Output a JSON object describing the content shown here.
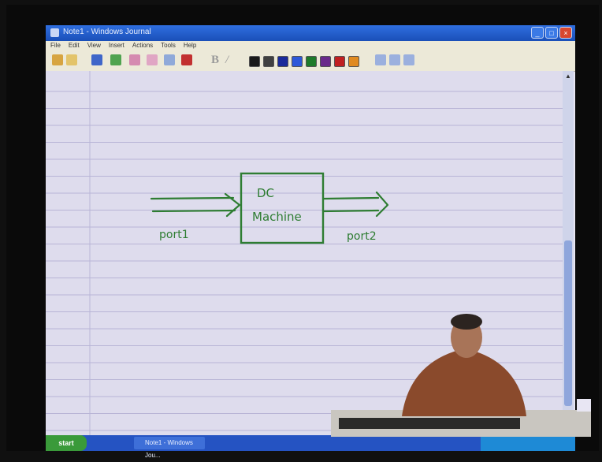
{
  "window": {
    "title": "Note1 - Windows Journal",
    "controls": [
      "_",
      "□",
      "×"
    ]
  },
  "menu": [
    "File",
    "Edit",
    "View",
    "Insert",
    "Actions",
    "Tools",
    "Help"
  ],
  "toolbar": {
    "bold_label": "B",
    "italic_label": "/",
    "colors": [
      "#1a1a1a",
      "#404040",
      "#1a2a9a",
      "#2d58d8",
      "#1e7a2a",
      "#6a2a8a",
      "#c02020",
      "#e08a20"
    ]
  },
  "note": {
    "block_label_line1": "DC",
    "block_label_line2": "Machine",
    "port1_label": "port1",
    "port2_label": "port2",
    "ink_color": "#2e7d32"
  },
  "taskbar": {
    "start_label": "start",
    "task_label": "Note1 - Windows Jou..."
  }
}
